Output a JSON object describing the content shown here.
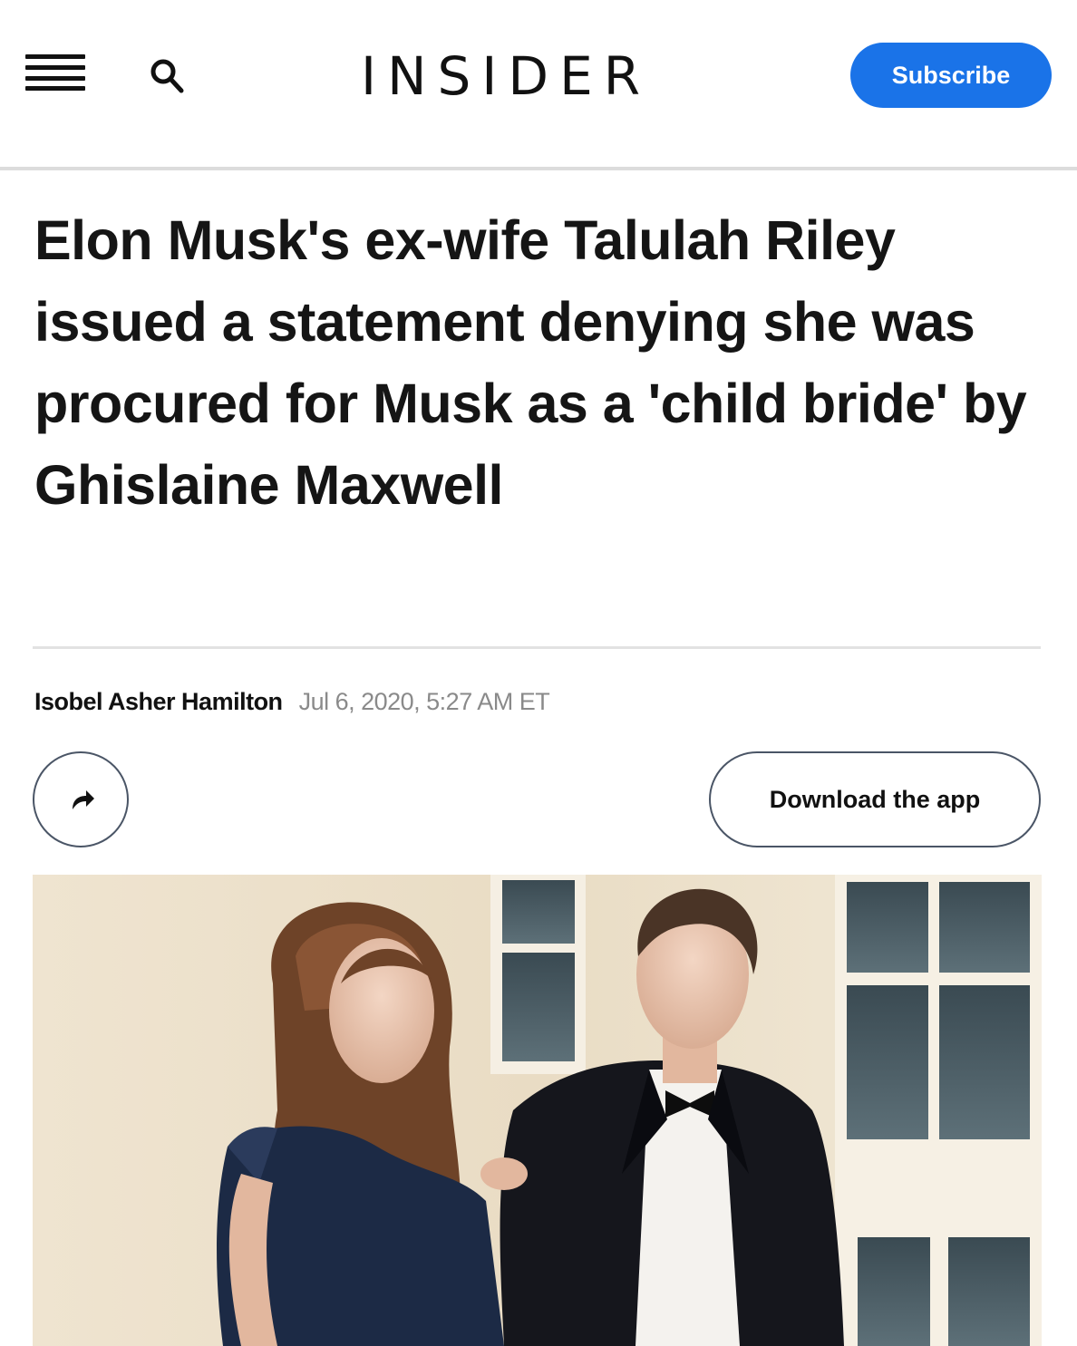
{
  "header": {
    "logo": "INSIDER",
    "subscribe_label": "Subscribe",
    "menu_icon": "hamburger-menu-icon",
    "search_icon": "search-icon",
    "accent_color": "#1a73e8"
  },
  "article": {
    "headline": "Elon Musk's ex-wife Talulah Riley issued a statement denying she was procured for Musk as a 'child bride' by Ghislaine Maxwell",
    "author": "Isobel Asher Hamilton",
    "timestamp": "Jul 6, 2020, 5:27 AM ET"
  },
  "actions": {
    "share_icon": "share-arrow-icon",
    "download_label": "Download the app"
  }
}
